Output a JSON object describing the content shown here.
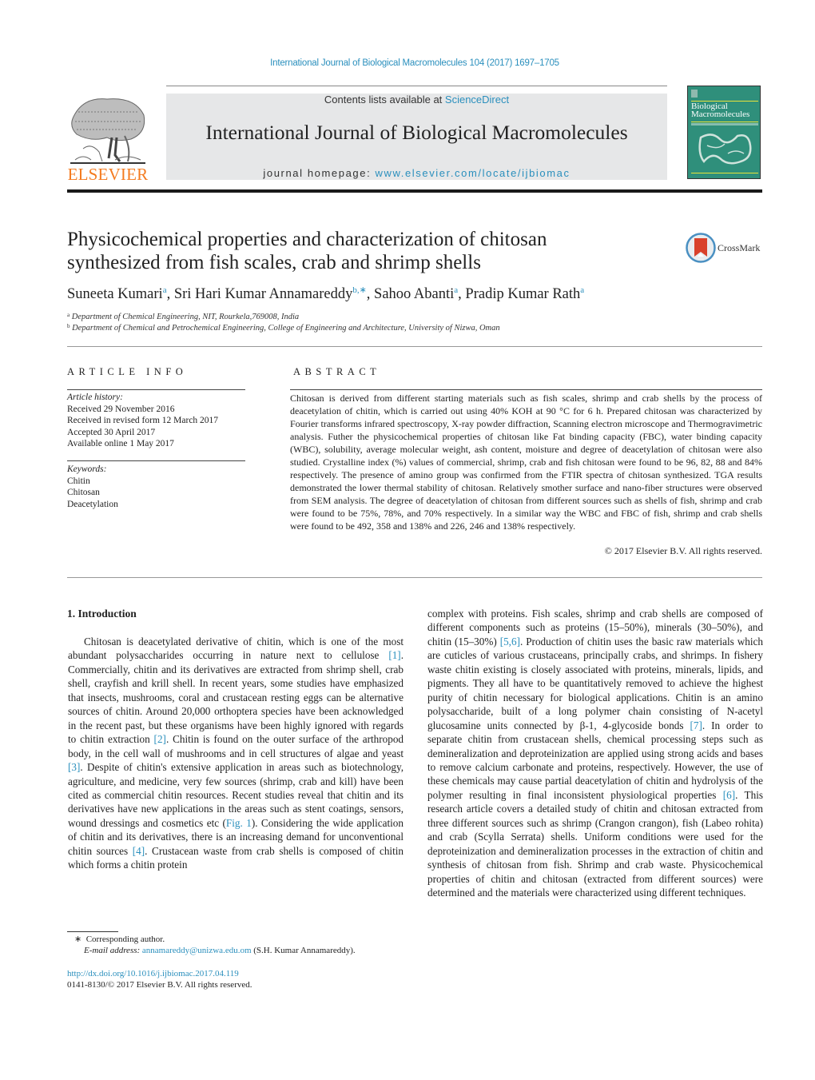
{
  "running_head": "International Journal of Biological Macromolecules 104 (2017) 1697–1705",
  "header": {
    "publisher_logo_word": "ELSEVIER",
    "contents_prefix": "Contents lists available at ",
    "contents_link": "ScienceDirect",
    "journal_title": "International Journal of Biological Macromolecules",
    "homepage_prefix": "journal homepage: ",
    "homepage_link": "www.elsevier.com/locate/ijbiomac",
    "cover_title_line1": "Biological",
    "cover_title_line2": "Macromolecules"
  },
  "article": {
    "title_line1": "Physicochemical properties and characterization of chitosan",
    "title_line2": "synthesized from fish scales, crab and shrimp shells",
    "crossmark_label": "CrossMark",
    "authors": [
      {
        "name": "Suneeta Kumari",
        "sup": "a",
        "sep": ", "
      },
      {
        "name": "Sri Hari Kumar Annamareddy",
        "sup": "b,∗",
        "sep": ", "
      },
      {
        "name": "Sahoo Abanti",
        "sup": "a",
        "sep": ", "
      },
      {
        "name": "Pradip Kumar Rath",
        "sup": "a",
        "sep": ""
      }
    ],
    "affiliations": [
      {
        "mark": "a",
        "text": "Department of Chemical Engineering, NIT, Rourkela,769008, India"
      },
      {
        "mark": "b",
        "text": "Department of Chemical and Petrochemical Engineering, College of Engineering and Architecture, University of Nizwa, Oman"
      }
    ]
  },
  "article_info": {
    "heading": "ARTICLE INFO",
    "history_label": "Article history:",
    "history": [
      "Received 29 November 2016",
      "Received in revised form 12 March 2017",
      "Accepted 30 April 2017",
      "Available online 1 May 2017"
    ],
    "keywords_label": "Keywords:",
    "keywords": [
      "Chitin",
      "Chitosan",
      "Deacetylation"
    ]
  },
  "abstract": {
    "heading": "ABSTRACT",
    "text": "Chitosan is derived from different starting materials such as fish scales, shrimp and crab shells by the process of deacetylation of chitin, which is carried out using 40% KOH at 90 °C for 6 h. Prepared chitosan was characterized by Fourier transforms infrared spectroscopy, X-ray powder diffraction, Scanning electron microscope and Thermogravimetric analysis. Futher the physicochemical properties of chitosan like Fat binding capacity (FBC), water binding capacity (WBC), solubility, average molecular weight, ash content, moisture and degree of deacetylation of chitosan were also studied. Crystalline index (%) values of commercial, shrimp, crab and fish chitosan were found to be 96, 82, 88 and 84% respectively. The presence of amino group was confirmed from the FTIR spectra of chitosan synthesized. TGA results demonstrated the lower thermal stability of chitosan. Relatively smother surface and nano-fiber structures were observed from SEM analysis. The degree of deacetylation of chitosan from different sources such as shells of fish, shrimp and crab were found to be 75%, 78%, and 70% respectively. In a similar way the WBC and FBC of fish, shrimp and crab shells were found to be 492, 358 and 138% and 226, 246 and 138% respectively.",
    "copyright": "© 2017 Elsevier B.V. All rights reserved."
  },
  "introduction": {
    "heading": "1.  Introduction",
    "left_column": [
      {
        "t": "Chitosan is deacetylated derivative of chitin, which is one of the most abundant polysaccharides occurring in nature next to cellulose "
      },
      {
        "ref": "[1]"
      },
      {
        "t": ". Commercially, chitin and its derivatives are extracted from shrimp shell, crab shell, crayfish and krill shell. In recent years, some studies have emphasized that insects, mushrooms, coral and crustacean resting eggs can be alternative sources of chitin. Around 20,000 orthoptera species have been acknowledged in the recent past, but these organisms have been highly ignored with regards to chitin extraction "
      },
      {
        "ref": "[2]"
      },
      {
        "t": ". Chitin is found on the outer surface of the arthropod body, in the cell wall of mushrooms and in cell structures of algae and yeast "
      },
      {
        "ref": "[3]"
      },
      {
        "t": ". Despite of chitin's extensive application in areas such as biotechnology, agriculture, and medicine, very few sources (shrimp, crab and kill) have been cited as commercial chitin resources. Recent studies reveal that chitin and its derivatives have new applications in the areas such as stent coatings, sensors, wound dressings and cosmetics etc ("
      },
      {
        "ref": "Fig. 1"
      },
      {
        "t": "). Considering the wide application of chitin and its derivatives, there is an increasing demand for unconventional chitin sources "
      },
      {
        "ref": "[4]"
      },
      {
        "t": ". Crustacean waste from crab shells is composed of chitin which forms a chitin protein"
      }
    ],
    "right_column": [
      {
        "t": "complex with proteins. Fish scales, shrimp and crab shells are composed of different components such as proteins (15–50%), minerals (30–50%), and chitin (15–30%) "
      },
      {
        "ref": "[5,6]"
      },
      {
        "t": ". Production of chitin uses the basic raw materials which are cuticles of various crustaceans, principally crabs, and shrimps. In fishery waste chitin existing is closely associated with proteins, minerals, lipids, and pigments. They all have to be quantitatively removed to achieve the highest purity of chitin necessary for biological applications. Chitin is an amino polysaccharide, built of a long polymer chain consisting of N-acetyl glucosamine units connected by β-1, 4-glycoside bonds "
      },
      {
        "ref": "[7]"
      },
      {
        "t": ". In order to separate chitin from crustacean shells, chemical processing steps such as demineralization and deproteinization are applied using strong acids and bases to remove calcium carbonate and proteins, respectively. However, the use of these chemicals may cause partial deacetylation of chitin and hydrolysis of the polymer resulting in final inconsistent physiological properties "
      },
      {
        "ref": "[6]"
      },
      {
        "t": ". This research article covers a detailed study of chitin and chitosan extracted from three different sources such as shrimp (Crangon crangon), fish (Labeo rohita) and crab (Scylla Serrata) shells. Uniform conditions were used for the deproteinization and demineralization processes in the extraction of chitin and synthesis of chitosan from fish. Shrimp and crab waste. Physicochemical properties of chitin and chitosan (extracted from different sources) were determined and the materials were characterized using different techniques."
      }
    ]
  },
  "footnotes": {
    "corresponding_mark": "∗",
    "corresponding_text": "Corresponding author.",
    "email_label": "E-mail address: ",
    "email": "annamareddy@unizwa.edu.om",
    "email_owner": " (S.H. Kumar Annamareddy).",
    "doi": "http://dx.doi.org/10.1016/j.ijbiomac.2017.04.119",
    "issn": "0141-8130/© 2017 Elsevier B.V. All rights reserved."
  },
  "colors": {
    "link": "#2a8fbd",
    "elsevier_orange": "#f47b20",
    "banner_gray": "#e6e7e8",
    "cover_teal": "#2f8f7b",
    "crossmark_red": "#d9412b"
  }
}
